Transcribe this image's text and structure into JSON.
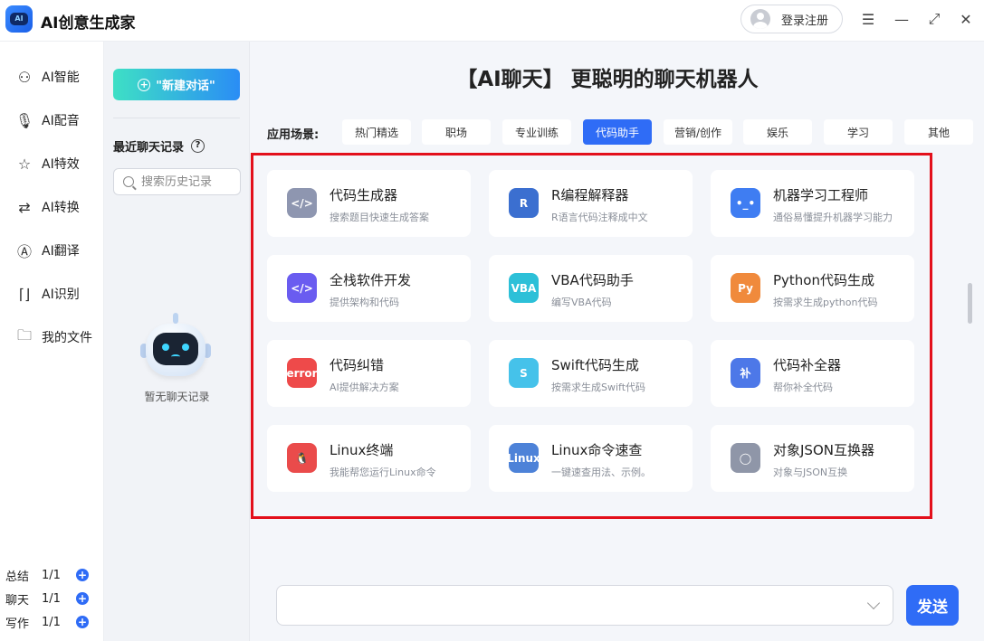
{
  "app": {
    "title": "AI创意生成家",
    "logo_text": "AI"
  },
  "header": {
    "login_label": "登录注册"
  },
  "nav": {
    "items": [
      {
        "label": "AI智能",
        "icon": "robot-icon"
      },
      {
        "label": "AI配音",
        "icon": "microphone-icon"
      },
      {
        "label": "AI特效",
        "icon": "sparkle-icon"
      },
      {
        "label": "AI转换",
        "icon": "convert-icon"
      },
      {
        "label": "AI翻译",
        "icon": "translate-icon"
      },
      {
        "label": "AI识别",
        "icon": "scan-icon"
      },
      {
        "label": "我的文件",
        "icon": "folder-icon"
      }
    ],
    "quotas": [
      {
        "label": "总结",
        "count": "1/1"
      },
      {
        "label": "聊天",
        "count": "1/1"
      },
      {
        "label": "写作",
        "count": "1/1"
      }
    ]
  },
  "history": {
    "new_chat_label": "\"新建对话\"",
    "title": "最近聊天记录",
    "search_placeholder": "搜索历史记录",
    "empty_text": "暂无聊天记录"
  },
  "main": {
    "headline": "【AI聊天】 更聪明的聊天机器人",
    "scenario_label": "应用场景:",
    "tabs": [
      "热门精选",
      "职场",
      "专业训练",
      "代码助手",
      "营销/创作",
      "娱乐",
      "学习",
      "其他"
    ],
    "active_tab": "代码助手",
    "tools": [
      {
        "name": "代码生成器",
        "desc": "搜索题目快速生成答案",
        "icon": "code-window-icon",
        "icon_text": "</>",
        "color": "#8e96b0"
      },
      {
        "name": "R编程解释器",
        "desc": "R语言代码注释成中文",
        "icon": "r-language-icon",
        "icon_text": "R",
        "color": "#3b6fd0"
      },
      {
        "name": "机器学习工程师",
        "desc": "通俗易懂提升机器学习能力",
        "icon": "robot-face-icon",
        "icon_text": "•_•",
        "color": "#3f7df2"
      },
      {
        "name": "全栈软件开发",
        "desc": "提供架构和代码",
        "icon": "cube-code-icon",
        "icon_text": "</>",
        "color": "#6a5cf0"
      },
      {
        "name": "VBA代码助手",
        "desc": "编写VBA代码",
        "icon": "vba-icon",
        "icon_text": "VBA",
        "color": "#2cc0d8"
      },
      {
        "name": "Python代码生成",
        "desc": "按需求生成python代码",
        "icon": "python-icon",
        "icon_text": "Py",
        "color": "#f08a3c"
      },
      {
        "name": "代码纠错",
        "desc": "AI提供解决方案",
        "icon": "error-icon",
        "icon_text": "error",
        "color": "#ee4a4a"
      },
      {
        "name": "Swift代码生成",
        "desc": "按需求生成Swift代码",
        "icon": "swift-icon",
        "icon_text": "S",
        "color": "#45c2ea"
      },
      {
        "name": "代码补全器",
        "desc": "帮你补全代码",
        "icon": "complete-icon",
        "icon_text": "补",
        "color": "#4d78e8"
      },
      {
        "name": "Linux终端",
        "desc": "我能帮您运行Linux命令",
        "icon": "linux-terminal-icon",
        "icon_text": "🐧",
        "color": "#ea4b4b"
      },
      {
        "name": "Linux命令速查",
        "desc": "一键速查用法、示例。",
        "icon": "linux-command-icon",
        "icon_text": "Linux",
        "color": "#4d82d8"
      },
      {
        "name": "对象JSON互换器",
        "desc": "对象与JSON互换",
        "icon": "json-convert-icon",
        "icon_text": "◯",
        "color": "#8f96a8"
      }
    ],
    "send_label": "发送"
  }
}
